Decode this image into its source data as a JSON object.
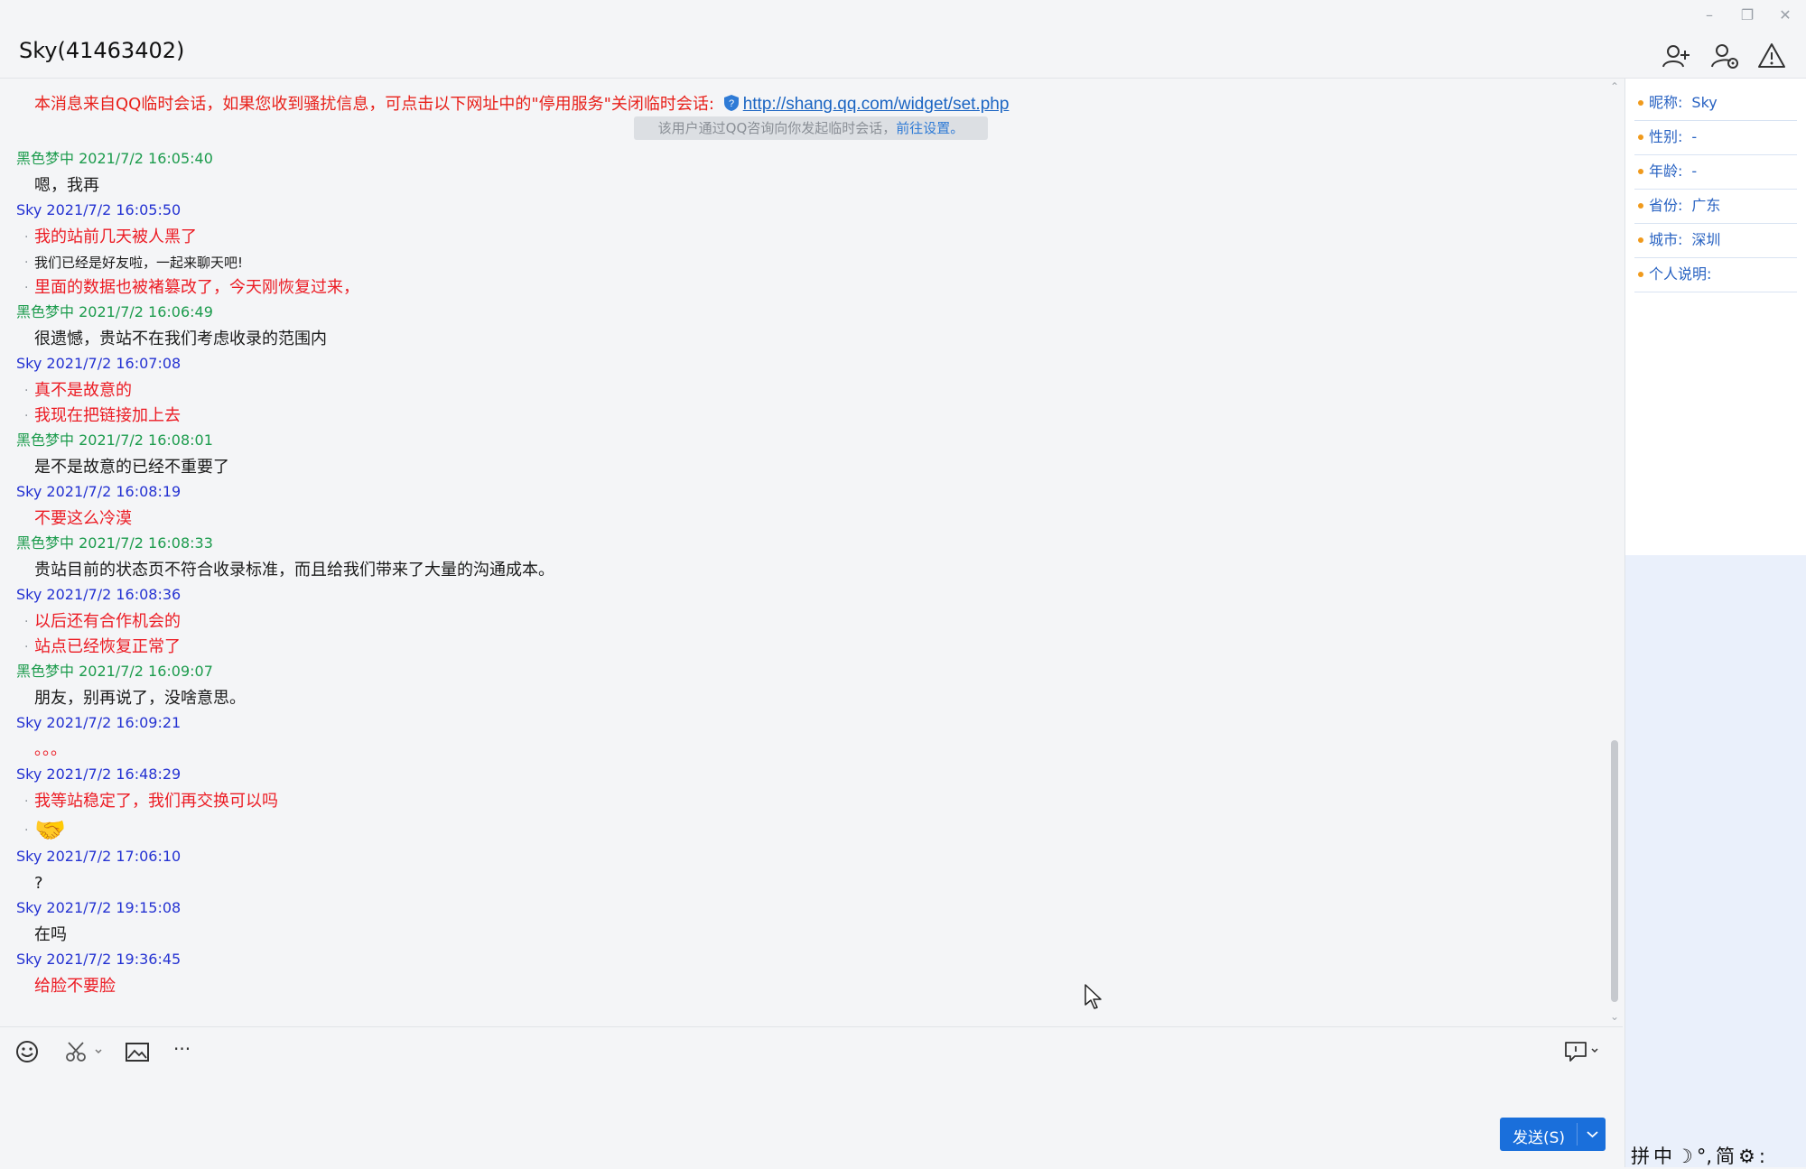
{
  "window": {
    "title": "Sky(41463402)",
    "controls": {
      "minimize": "–",
      "restore": "❐",
      "close": "✕"
    },
    "toolbar_icons": [
      "add-friend-icon",
      "user-settings-icon",
      "report-warning-icon"
    ]
  },
  "notice": {
    "text": "本消息来自QQ临时会话，如果您收到骚扰信息，可点击以下网址中的\"停用服务\"关闭临时会话:",
    "link": "http://shang.qq.com/widget/set.php",
    "pill_text": "该用户通过QQ咨询向你发起临时会话，",
    "pill_link": "前往设置。"
  },
  "messages": [
    {
      "sender": "黑色梦中 2021/7/2 16:05:40",
      "color": "green",
      "lines": [
        {
          "text": "嗯，我再",
          "style": "black",
          "bullet": false
        }
      ]
    },
    {
      "sender": "Sky 2021/7/2 16:05:50",
      "color": "blue",
      "lines": [
        {
          "text": "我的站前几天被人黑了",
          "style": "red",
          "bullet": true
        },
        {
          "text": "我们已经是好友啦，一起来聊天吧!",
          "style": "black small",
          "bullet": true
        },
        {
          "text": "里面的数据也被褚篡改了，今天刚恢复过来，",
          "style": "red",
          "bullet": true
        }
      ]
    },
    {
      "sender": "黑色梦中 2021/7/2 16:06:49",
      "color": "green",
      "lines": [
        {
          "text": "很遗憾，贵站不在我们考虑收录的范围内",
          "style": "black",
          "bullet": false
        }
      ]
    },
    {
      "sender": "Sky 2021/7/2 16:07:08",
      "color": "blue",
      "lines": [
        {
          "text": "真不是故意的",
          "style": "red",
          "bullet": true
        },
        {
          "text": "我现在把链接加上去",
          "style": "red",
          "bullet": true
        }
      ]
    },
    {
      "sender": "黑色梦中 2021/7/2 16:08:01",
      "color": "green",
      "lines": [
        {
          "text": "是不是故意的已经不重要了",
          "style": "black",
          "bullet": false
        }
      ]
    },
    {
      "sender": "Sky 2021/7/2 16:08:19",
      "color": "blue",
      "lines": [
        {
          "text": "不要这么冷漠",
          "style": "red",
          "bullet": false
        }
      ]
    },
    {
      "sender": "黑色梦中 2021/7/2 16:08:33",
      "color": "green",
      "lines": [
        {
          "text": "贵站目前的状态页不符合收录标准，而且给我们带来了大量的沟通成本。",
          "style": "black",
          "bullet": false
        }
      ]
    },
    {
      "sender": "Sky 2021/7/2 16:08:36",
      "color": "blue",
      "lines": [
        {
          "text": "以后还有合作机会的",
          "style": "red",
          "bullet": true
        },
        {
          "text": "站点已经恢复正常了",
          "style": "red",
          "bullet": true
        }
      ]
    },
    {
      "sender": "黑色梦中 2021/7/2 16:09:07",
      "color": "green",
      "lines": [
        {
          "text": "朋友，别再说了，没啥意思。",
          "style": "black",
          "bullet": false
        }
      ]
    },
    {
      "sender": "Sky 2021/7/2 16:09:21",
      "color": "blue",
      "lines": [
        {
          "text": "。。。",
          "style": "red",
          "bullet": false
        }
      ]
    },
    {
      "sender": "Sky 2021/7/2 16:48:29",
      "color": "blue",
      "lines": [
        {
          "text": "我等站稳定了，我们再交换可以吗",
          "style": "red",
          "bullet": true
        },
        {
          "text": "🤝",
          "style": "emoji tall",
          "bullet": true
        }
      ]
    },
    {
      "sender": "Sky 2021/7/2 17:06:10",
      "color": "blue",
      "lines": [
        {
          "text": "?",
          "style": "black",
          "bullet": false
        }
      ]
    },
    {
      "sender": "Sky 2021/7/2 19:15:08",
      "color": "blue",
      "lines": [
        {
          "text": "在吗",
          "style": "black",
          "bullet": false
        }
      ]
    },
    {
      "sender": "Sky 2021/7/2 19:36:45",
      "color": "blue",
      "lines": [
        {
          "text": "给脸不要脸",
          "style": "red",
          "bullet": false
        }
      ]
    }
  ],
  "compose": {
    "icons": [
      "emoji-icon",
      "scissors-icon",
      "image-icon",
      "more-icon"
    ],
    "more_label": "···",
    "send_label": "发送(S)"
  },
  "profile": [
    {
      "key": "昵称:",
      "value": "Sky"
    },
    {
      "key": "性别:",
      "value": "-"
    },
    {
      "key": "年龄:",
      "value": "-"
    },
    {
      "key": "省份:",
      "value": "广东"
    },
    {
      "key": "城市:",
      "value": "深圳"
    },
    {
      "key": "个人说明:",
      "value": ""
    }
  ],
  "ime_bar": [
    "拼",
    "中",
    "☽",
    "°,",
    "简",
    "⚙",
    ":"
  ],
  "colors": {
    "sender_green": "#1b9b4c",
    "sender_blue": "#2432d2",
    "message_red": "#ec1c24",
    "send_button": "#1a6fdb"
  }
}
